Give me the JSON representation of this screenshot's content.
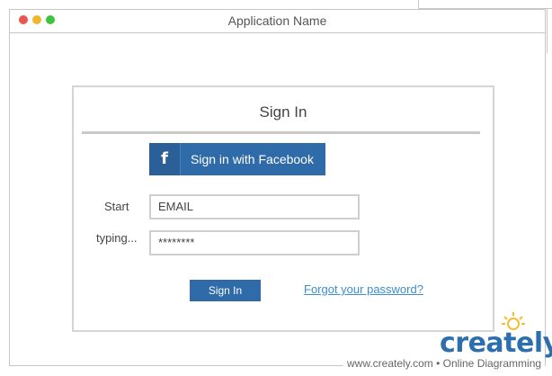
{
  "window": {
    "title": "Application Name"
  },
  "signin": {
    "title": "Sign In",
    "facebook_label": "Sign in with Facebook",
    "facebook_icon": "f",
    "label_start": "Start",
    "label_typing": "typing...",
    "email_value": "EMAIL",
    "password_value": "********",
    "button_label": "Sign In",
    "forgot_link": "Forgot your password?"
  },
  "watermark": {
    "logo": "creately",
    "footer": "www.creately.com • Online Diagramming"
  },
  "colors": {
    "accent": "#2f6aa9",
    "link": "#3a8fd0",
    "close_dot": "#e9564f",
    "minimize_dot": "#f1b52f",
    "maximize_dot": "#3fc33f"
  }
}
